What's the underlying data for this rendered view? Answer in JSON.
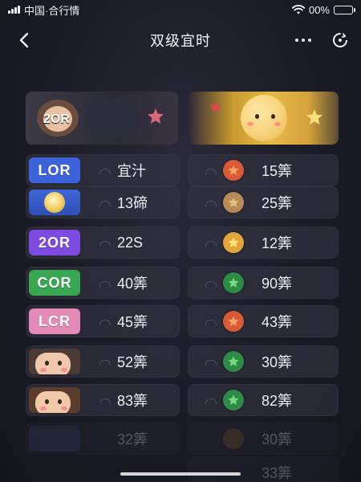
{
  "status_bar": {
    "carrier": "中国·合行情",
    "battery": "00%"
  },
  "nav": {
    "title": "双级宜时"
  },
  "badges": {
    "row1": "LOR",
    "row3": "2OR",
    "row4": "COR",
    "row5": "LCR"
  },
  "banner": {
    "left_badge": "2OR"
  },
  "rows_left": [
    {
      "label": "宜汁"
    },
    {
      "label": "13碲"
    },
    {
      "label": "22S"
    },
    {
      "label": "40筭"
    },
    {
      "label": "45筭"
    },
    {
      "label": "52筭"
    },
    {
      "label": "83筭"
    },
    {
      "label": "32筭"
    }
  ],
  "rows_right": [
    {
      "label": "15筭"
    },
    {
      "label": "25筭"
    },
    {
      "label": "12筭"
    },
    {
      "label": "90筭"
    },
    {
      "label": "43筭"
    },
    {
      "label": "30筭"
    },
    {
      "label": "82筭"
    },
    {
      "label": "30筭"
    },
    {
      "label": "33筭"
    }
  ],
  "colors": {
    "background": "#1d1d29",
    "card": "#343442",
    "gold": "#e7b948",
    "purple": "#7d4be0",
    "blue": "#3c63d9",
    "green": "#39a652",
    "pink": "#e38ab7",
    "coin_red": "#d85a37",
    "coin_bronze": "#b98a59",
    "coin_gold": "#e0a63b",
    "coin_green": "#2e8b45"
  },
  "icons": {
    "back": "back-chevron-icon",
    "more": "more-dots-icon",
    "refresh": "refresh-icon",
    "wifi": "wifi-icon",
    "battery": "battery-icon",
    "signal": "signal-icon",
    "star": "star-icon"
  }
}
